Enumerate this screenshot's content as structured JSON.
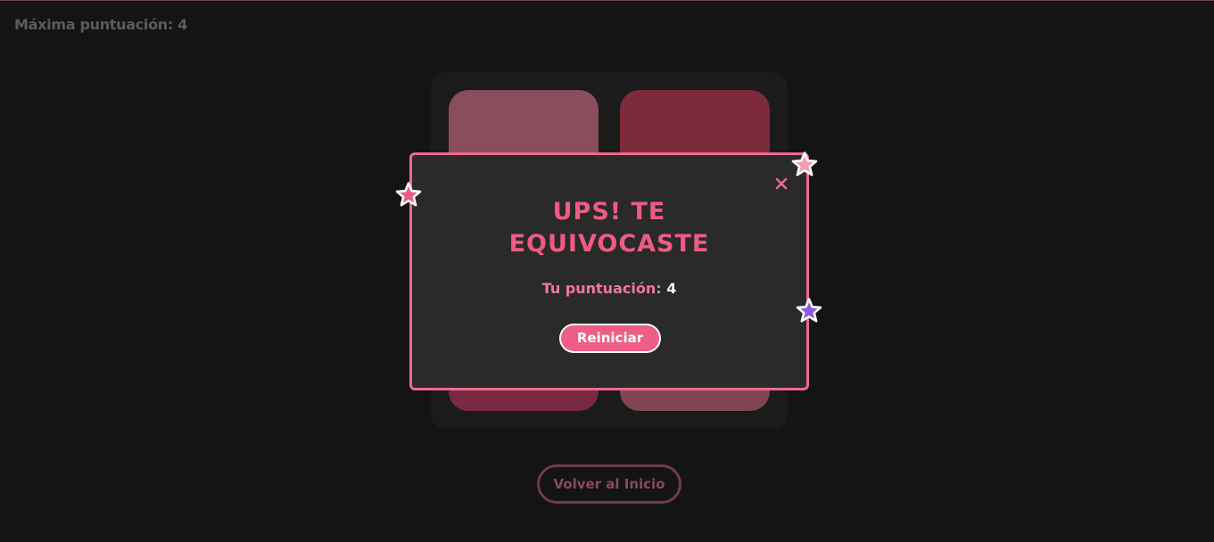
{
  "header": {
    "high_score_label": "Máxima puntuación: 4"
  },
  "board": {
    "tiles": [
      {
        "position": "top-left",
        "color": "#8a4d5c"
      },
      {
        "position": "top-right",
        "color": "#7d2b3b"
      },
      {
        "position": "bottom-left",
        "color": "#7a2943"
      },
      {
        "position": "bottom-right",
        "color": "#7f4552"
      }
    ]
  },
  "footer": {
    "home_button_label": "Volver al Inicio"
  },
  "modal": {
    "title_line1": "UPS! TE",
    "title_line2": "EQUIVOCASTE",
    "score_label": "Tu puntuación:",
    "score_value": "4",
    "restart_label": "Reiniciar",
    "close_icon": "close-icon"
  },
  "decorations": {
    "stars": [
      {
        "name": "star-left",
        "color": "#ee5b83"
      },
      {
        "name": "star-top-right",
        "color": "#f59ab2"
      },
      {
        "name": "star-right",
        "color": "#8a5ae6"
      }
    ]
  },
  "colors": {
    "background": "#141414",
    "accent": "#f06a8e",
    "modal_bg": "#2a2a2a"
  }
}
